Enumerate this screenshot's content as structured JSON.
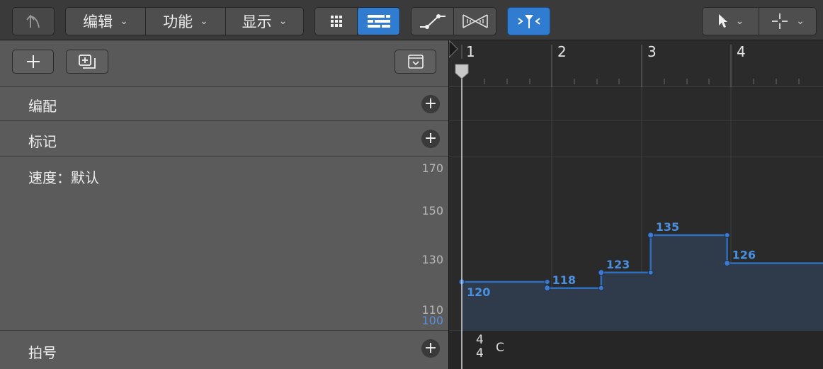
{
  "toolbar": {
    "back_icon": "catch-arrow-icon",
    "menus": [
      {
        "label": "编辑",
        "icon": "chevron-down-icon"
      },
      {
        "label": "功能",
        "icon": "chevron-down-icon"
      },
      {
        "label": "显示",
        "icon": "chevron-down-icon"
      }
    ],
    "view_toggle": {
      "grid_icon": "grid-view-icon",
      "list_icon": "list-view-icon",
      "selected": "list"
    },
    "automation_icons": [
      "node-curve-icon",
      "waveform-icon"
    ],
    "flex_icon": "flex-time-icon",
    "tools": [
      {
        "icon": "pointer-tool-icon",
        "chevron": "chevron-down-icon"
      },
      {
        "icon": "crosshair-tool-icon",
        "chevron": "chevron-down-icon"
      }
    ]
  },
  "left": {
    "header_buttons": [
      "add-icon",
      "duplicate-track-icon",
      "collapse-icon"
    ],
    "tracks": [
      {
        "label": "编配"
      },
      {
        "label": "标记"
      },
      {
        "label": "速度：默认",
        "scale": [
          "170",
          "150",
          "130",
          "110",
          "100"
        ]
      },
      {
        "label": "拍号"
      }
    ]
  },
  "ruler": {
    "bars": [
      "1",
      "2",
      "3",
      "4"
    ]
  },
  "chart_data": {
    "type": "line",
    "title": "",
    "xlabel": "",
    "ylabel": "",
    "x_unit": "bars",
    "x_bars": [
      1,
      2,
      3,
      4
    ],
    "ylim": [
      100,
      170
    ],
    "yticks": [
      "170",
      "150",
      "130",
      "110",
      "100"
    ],
    "series": [
      {
        "points": [
          {
            "x": 1.0,
            "y": 120,
            "label": "120"
          },
          {
            "x": 1.95,
            "y": 118,
            "label": "118"
          },
          {
            "x": 2.55,
            "y": 123,
            "label": "123"
          },
          {
            "x": 3.1,
            "y": 135,
            "label": "135"
          },
          {
            "x": 3.95,
            "y": 126,
            "label": "126"
          }
        ]
      }
    ],
    "colors": {
      "line": "#2f6fbf",
      "fill": "#2f3a4b",
      "label": "#4a90e2"
    }
  },
  "signature": {
    "top": "4",
    "bottom": "4",
    "key": "C"
  }
}
